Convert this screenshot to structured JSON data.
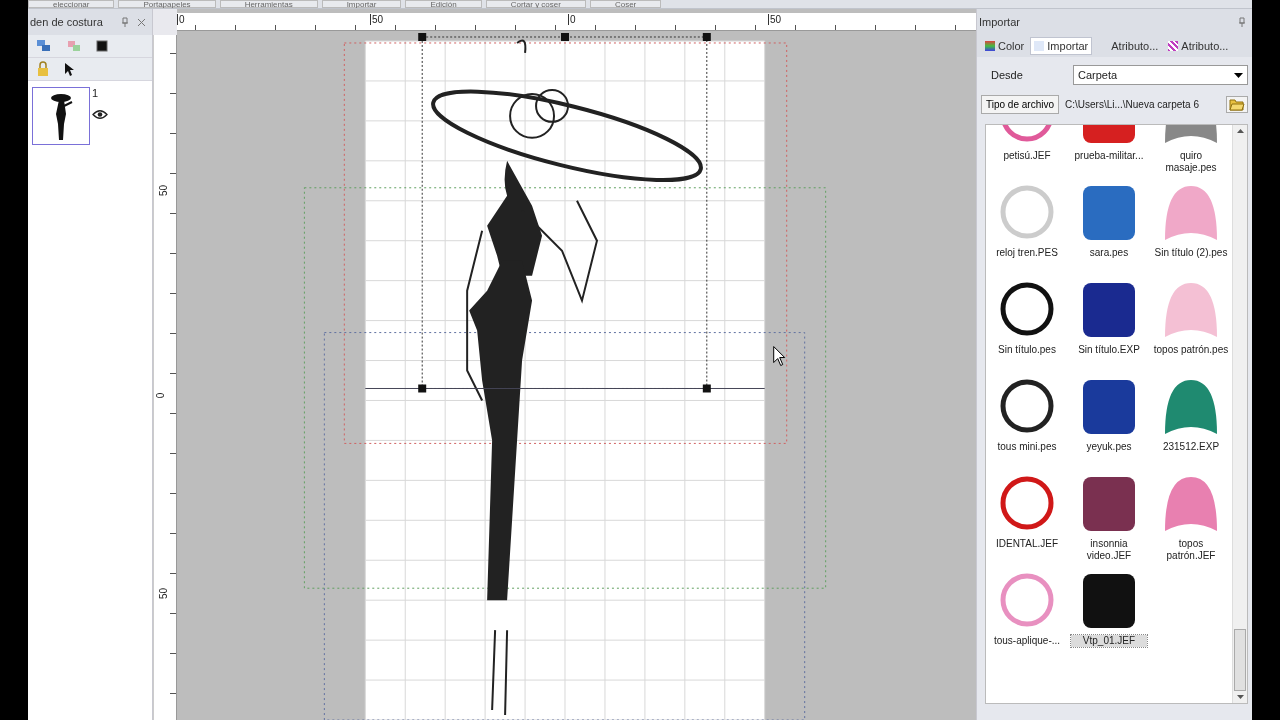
{
  "ribbon_groups": [
    "eleccionar",
    "Portapapeles",
    "Herramientas",
    "Importar",
    "Edición",
    "Cortar y coser",
    "Coser"
  ],
  "left_panel": {
    "title": "den de costura",
    "layers": [
      {
        "number": "1",
        "visible": true,
        "selected": true
      }
    ]
  },
  "rulers": {
    "horizontal": [
      "0",
      "50",
      "0",
      "50"
    ],
    "vertical": [
      "50",
      "0",
      "50"
    ]
  },
  "import_panel": {
    "title": "Importar",
    "tabs": [
      {
        "label": "Color",
        "selected": false
      },
      {
        "label": "Importar",
        "selected": true
      },
      {
        "label": "Atributo...",
        "selected": false
      },
      {
        "label": "Atributo...",
        "selected": false
      }
    ],
    "from_label": "Desde",
    "from_value": "Carpeta",
    "file_type_button": "Tipo de archivo",
    "path": "C:\\Users\\Li...\\Nueva carpeta 6",
    "files": [
      {
        "name": "petisú.JEF",
        "selected": false
      },
      {
        "name": "prueba-militar...",
        "selected": false
      },
      {
        "name": "quiro masaje.pes",
        "selected": false
      },
      {
        "name": "reloj tren.PES",
        "selected": false
      },
      {
        "name": "sara.pes",
        "selected": false
      },
      {
        "name": "Sin título (2).pes",
        "selected": false
      },
      {
        "name": "Sin título.pes",
        "selected": false
      },
      {
        "name": "Sin título.EXP",
        "selected": false
      },
      {
        "name": "topos patrón.pes",
        "selected": false
      },
      {
        "name": "tous mini.pes",
        "selected": false
      },
      {
        "name": "yeyuk.pes",
        "selected": false
      },
      {
        "name": "231512.EXP",
        "selected": false
      },
      {
        "name": "IDENTAL.JEF",
        "selected": false
      },
      {
        "name": "insonnia video.JEF",
        "selected": false
      },
      {
        "name": "topos patrón.JEF",
        "selected": false
      },
      {
        "name": "tous-aplique-...",
        "selected": false
      },
      {
        "name": "Vtp_01.JEF",
        "selected": true
      }
    ]
  }
}
